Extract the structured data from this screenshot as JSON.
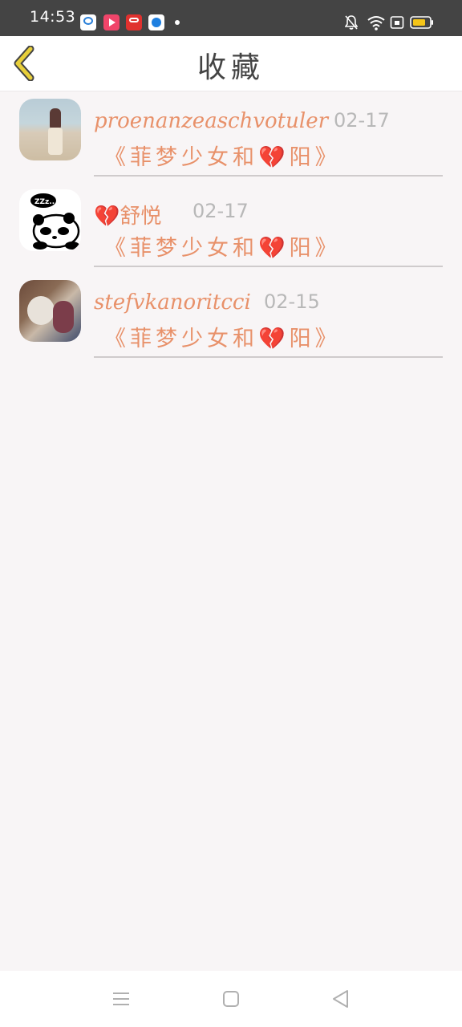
{
  "status_bar": {
    "time": "14:53",
    "notification_icons": [
      "browser-app-icon",
      "video-app-icon",
      "red-app-icon",
      "blue-app-icon"
    ],
    "system_icons": [
      "bell-muted-icon",
      "wifi-icon",
      "sim-icon",
      "battery-icon"
    ]
  },
  "header": {
    "title": "收藏",
    "back_icon": "chevron-left-icon"
  },
  "favorites": [
    {
      "avatar": "beach-girl-photo",
      "name": "proenanzeaschvotuler",
      "date": "02-17",
      "book": "《菲梦少女和💔阳》"
    },
    {
      "avatar": "panda-sleeping-photo",
      "name": "💔舒悦",
      "date": "02-17",
      "book": "《菲梦少女和💔阳》"
    },
    {
      "avatar": "dog-and-child-photo",
      "name": "stefvkanoritcci",
      "date": "02-15",
      "book": "《菲梦少女和💔阳》"
    }
  ],
  "nav_bar": {
    "buttons": [
      "menu-icon",
      "home-icon",
      "back-triangle-icon"
    ]
  },
  "colors": {
    "accent": "#e8916a",
    "status_bar": "#444444",
    "background": "#f8f5f6",
    "back_chevron": "#e8cf3a"
  }
}
